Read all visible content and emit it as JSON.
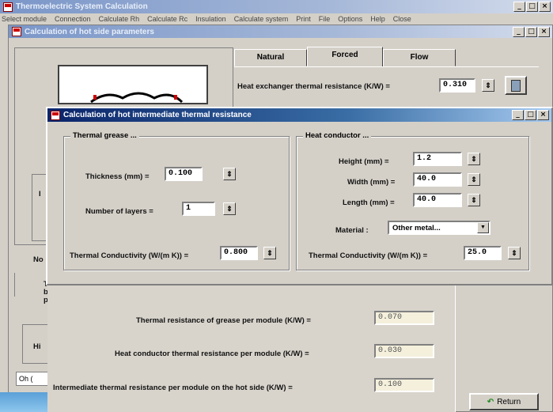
{
  "app": {
    "title": "Thermoelectric System Calculation",
    "menu": [
      "Select module",
      "Connection",
      "Calculate Rh",
      "Calculate Rc",
      "Insulation",
      "Calculate system",
      "Print",
      "File",
      "Options",
      "Help",
      "Close"
    ]
  },
  "hot_window": {
    "title": "Calculation of hot side parameters",
    "tabs": [
      "Natural",
      "Forced",
      "Flow"
    ],
    "active_tab": "Forced",
    "hx_label": "Heat exchanger thermal resistance (K/W) =",
    "hx_value": "0.310",
    "left_labels": [
      "No",
      "Th",
      "be",
      "pe",
      "Hi",
      "Oh ("
    ],
    "partial_I": "I"
  },
  "inter_window": {
    "title": "Calculation of hot intermediate thermal resistance",
    "grease": {
      "title": "Thermal grease ...",
      "thickness_label": "Thickness  (mm) =",
      "thickness_value": "0.100",
      "layers_label": "Number of layers =",
      "layers_value": "1",
      "conductivity_label": "Thermal Conductivity  (W/(m K)) =",
      "conductivity_value": "0.800"
    },
    "conductor": {
      "title": "Heat conductor ...",
      "height_label": "Height  (mm) =",
      "height_value": "1.2",
      "width_label": "Width (mm) =",
      "width_value": "40.0",
      "length_label": "Length (mm) =",
      "length_value": "40.0",
      "material_label": "Material :",
      "material_value": "Other metal...",
      "conductivity_label": "Thermal Conductivity  (W/(m K)) =",
      "conductivity_value": "25.0"
    },
    "results": [
      {
        "label": "Thermal resistance of grease per module  (K/W)  =",
        "value": "0.070"
      },
      {
        "label": "Heat conductor thermal resistance per module (K/W)  =",
        "value": "0.030"
      },
      {
        "label": "Intermediate thermal resistance per module on the hot side (K/W) =",
        "value": "0.100"
      }
    ],
    "return_label": "Return"
  }
}
